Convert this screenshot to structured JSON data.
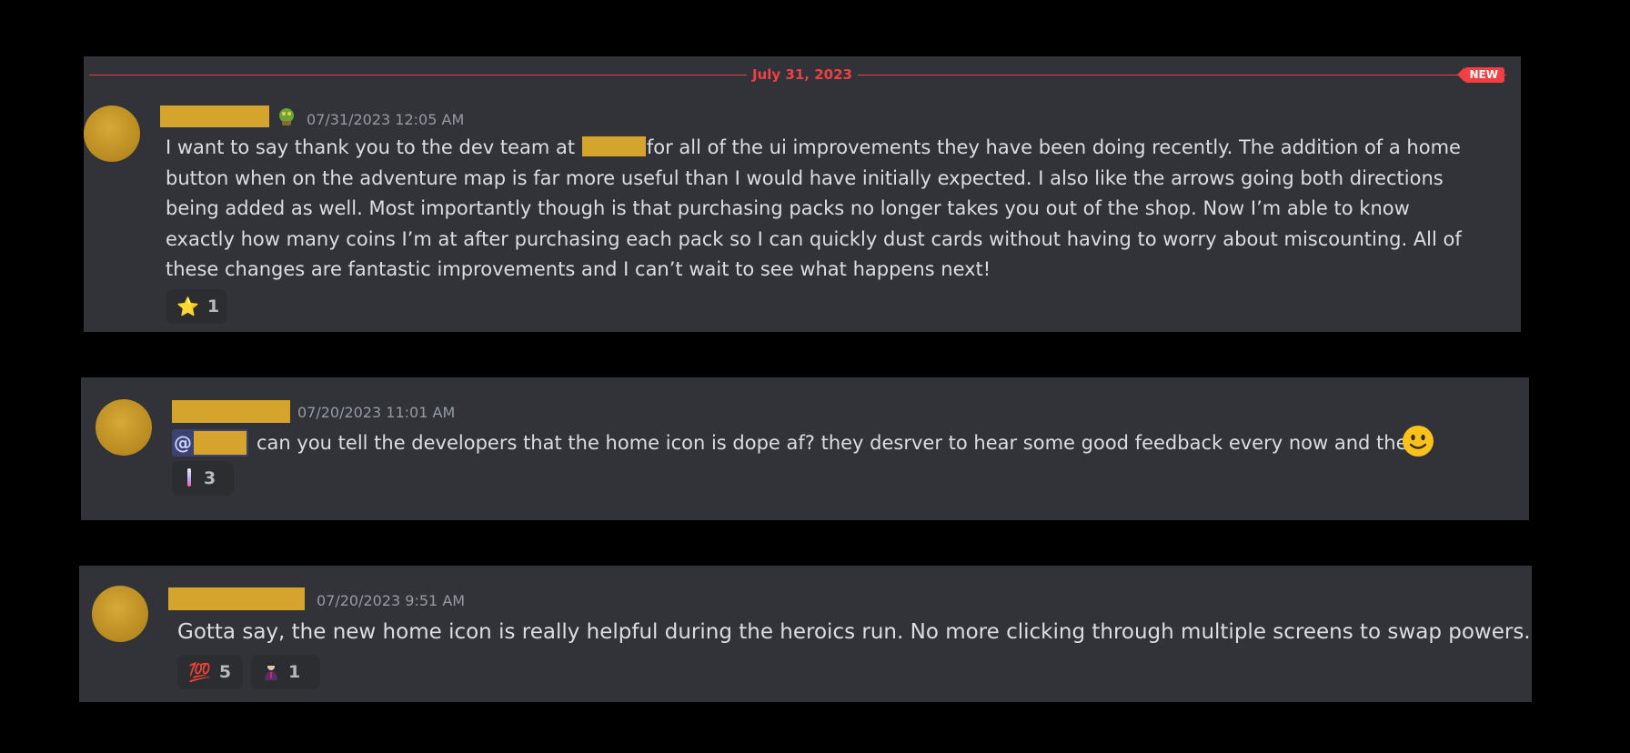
{
  "divider": {
    "date": "July 31, 2023",
    "badge": "NEW"
  },
  "messages": [
    {
      "timestamp": "07/31/2023 12:05 AM",
      "text_before": "I want to say thank you to the dev team at",
      "text_after": "for all of the ui improvements they have been doing recently. The addition of a home button when on the adventure map is far more useful than I would have initially expected. I also like the arrows going both directions being added as well. Most importantly though is that purchasing packs no longer takes you out of the shop. Now I’m able to know exactly how many coins I’m at after purchasing each pack so I can quickly dust cards without having to worry about miscounting. All of these changes are fantastic improvements and I can’t wait to see what happens next!",
      "reactions": [
        {
          "icon": "star-icon",
          "emoji": "⭐",
          "count": "1"
        }
      ]
    },
    {
      "timestamp": "07/20/2023 11:01 AM",
      "mention": "@",
      "text": "can you tell the developers that the home icon is dope af?  they desrver to hear some good feedback every now and then!",
      "reactions": [
        {
          "icon": "custom-emoji-icon",
          "emoji": "",
          "count": "3"
        }
      ]
    },
    {
      "timestamp": "07/20/2023 9:51 AM",
      "text": "Gotta say, the new home icon is really helpful during the heroics run. No more clicking through multiple screens to swap powers.",
      "reactions": [
        {
          "icon": "hundred-points-icon",
          "emoji": "💯",
          "count": "5"
        },
        {
          "icon": "custom-emoji-icon",
          "emoji": "",
          "count": "1"
        }
      ]
    }
  ]
}
